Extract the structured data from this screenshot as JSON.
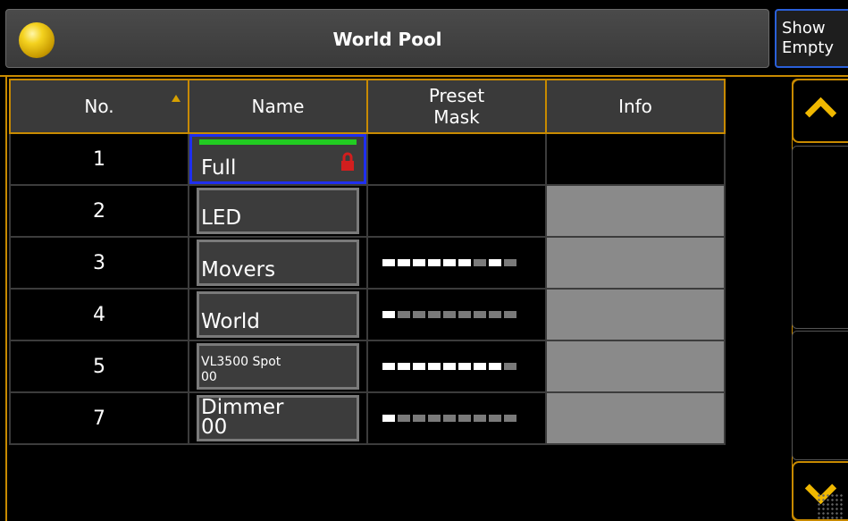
{
  "window": {
    "title": "World Pool",
    "icon": "yellow-ball-icon"
  },
  "show_empty": {
    "line1": "Show",
    "line2": "Empty"
  },
  "table": {
    "headers": {
      "no": "No.",
      "name": "Name",
      "preset_mask_line1": "Preset",
      "preset_mask_line2": "Mask",
      "info": "Info"
    },
    "sort_indicator": "sort-ascending-icon",
    "rows": [
      {
        "no": "1",
        "name": "Full",
        "locked": true,
        "selected": true,
        "mask": []
      },
      {
        "no": "2",
        "name": "LED",
        "mask": []
      },
      {
        "no": "3",
        "name": "Movers",
        "mask": [
          1,
          1,
          1,
          1,
          1,
          1,
          0,
          1,
          0
        ]
      },
      {
        "no": "4",
        "name": "World",
        "mask": [
          1,
          0,
          0,
          0,
          0,
          0,
          0,
          0,
          0
        ]
      },
      {
        "no": "5",
        "name_line1": "VL3500 Spot",
        "name_line2": "00",
        "mask": [
          1,
          1,
          1,
          1,
          1,
          1,
          1,
          1,
          0
        ]
      },
      {
        "no": "7",
        "name_line1": "Dimmer",
        "name_line2": "00",
        "mask": [
          1,
          0,
          0,
          0,
          0,
          0,
          0,
          0,
          0
        ]
      }
    ]
  },
  "colors": {
    "accent_orange": "#c88a00",
    "selection_blue": "#1f2ff0",
    "green_bar": "#22cc22",
    "lock_red": "#d21e1e"
  },
  "scrollbar": {
    "up": "chevron-up-icon",
    "down": "chevron-down-icon"
  }
}
